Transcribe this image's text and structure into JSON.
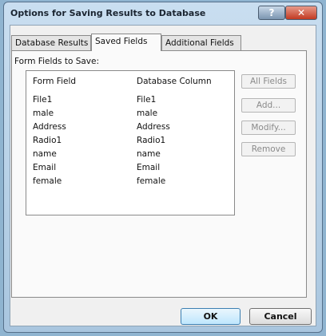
{
  "window": {
    "title": "Options for Saving Results to Database",
    "help_label": "?",
    "close_label": "✕"
  },
  "tabs": [
    {
      "label": "Database Results",
      "active": false
    },
    {
      "label": "Saved Fields",
      "active": true
    },
    {
      "label": "Additional Fields",
      "active": false
    }
  ],
  "panel": {
    "section_label": "Form Fields to Save:",
    "columns": [
      "Form Field",
      "Database Column"
    ],
    "rows": [
      [
        "File1",
        "File1"
      ],
      [
        "male",
        "male"
      ],
      [
        "Address",
        "Address"
      ],
      [
        "Radio1",
        "Radio1"
      ],
      [
        "name",
        "name"
      ],
      [
        "Email",
        "Email"
      ],
      [
        "female",
        "female"
      ]
    ]
  },
  "side_buttons": {
    "all_fields": "All Fields",
    "add": "Add...",
    "modify": "Modify...",
    "remove": "Remove"
  },
  "footer": {
    "ok": "OK",
    "cancel": "Cancel"
  }
}
